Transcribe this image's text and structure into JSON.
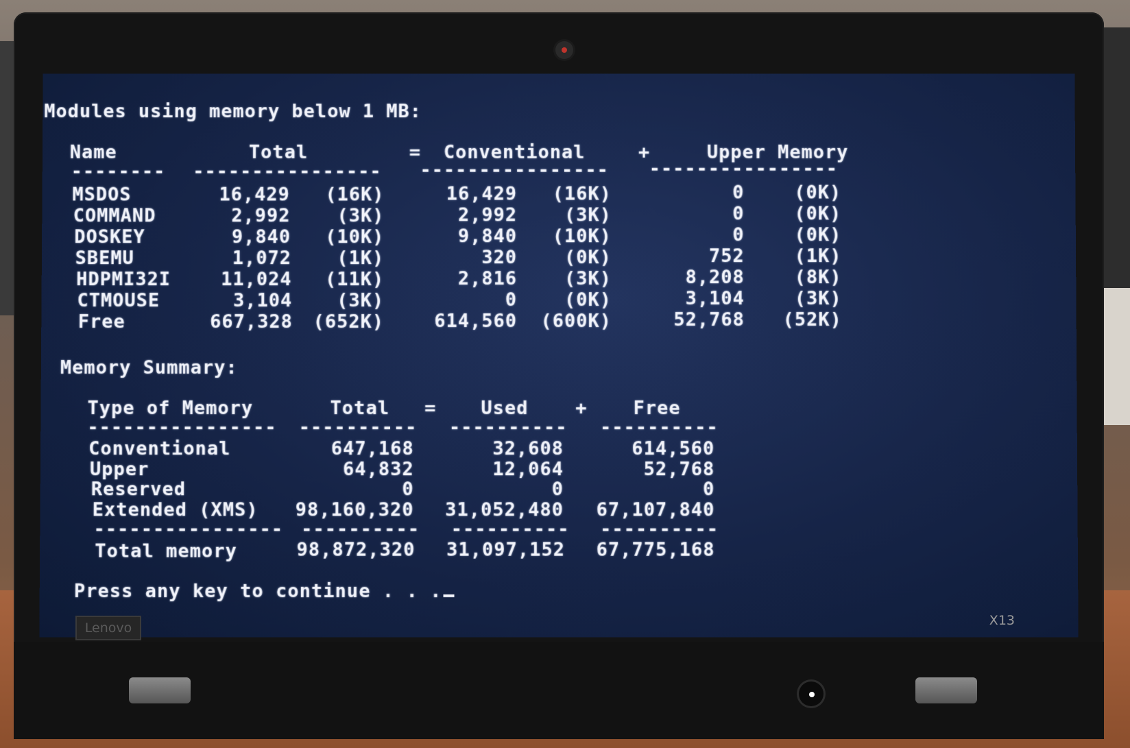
{
  "modules": {
    "heading": "Modules using memory below 1 MB:",
    "header": [
      "Name",
      "Total",
      "=",
      "Conventional",
      "+",
      "Upper Memory"
    ],
    "separator": "--------   ----------------    ----------------    ----------------",
    "rows": [
      {
        "name": "MSDOS",
        "total": "16,429",
        "total_k": "(16K)",
        "conv": "16,429",
        "conv_k": "(16K)",
        "upper": "0",
        "upper_k": "(0K)"
      },
      {
        "name": "COMMAND",
        "total": "2,992",
        "total_k": "(3K)",
        "conv": "2,992",
        "conv_k": "(3K)",
        "upper": "0",
        "upper_k": "(0K)"
      },
      {
        "name": "DOSKEY",
        "total": "9,840",
        "total_k": "(10K)",
        "conv": "9,840",
        "conv_k": "(10K)",
        "upper": "0",
        "upper_k": "(0K)"
      },
      {
        "name": "SBEMU",
        "total": "1,072",
        "total_k": "(1K)",
        "conv": "320",
        "conv_k": "(0K)",
        "upper": "752",
        "upper_k": "(1K)"
      },
      {
        "name": "HDPMI32I",
        "total": "11,024",
        "total_k": "(11K)",
        "conv": "2,816",
        "conv_k": "(3K)",
        "upper": "8,208",
        "upper_k": "(8K)"
      },
      {
        "name": "CTMOUSE",
        "total": "3,104",
        "total_k": "(3K)",
        "conv": "0",
        "conv_k": "(0K)",
        "upper": "3,104",
        "upper_k": "(3K)"
      },
      {
        "name": "Free",
        "total": "667,328",
        "total_k": "(652K)",
        "conv": "614,560",
        "conv_k": "(600K)",
        "upper": "52,768",
        "upper_k": "(52K)"
      }
    ]
  },
  "summary": {
    "heading": "Memory Summary:",
    "header": [
      "Type of Memory",
      "Total",
      "=",
      "Used",
      "+",
      "Free"
    ],
    "separator": "----------------  ----------  ----------  ----------",
    "rows": [
      {
        "type": "Conventional",
        "total": "647,168",
        "used": "32,608",
        "free": "614,560"
      },
      {
        "type": "Upper",
        "total": "64,832",
        "used": "12,064",
        "free": "52,768"
      },
      {
        "type": "Reserved",
        "total": "0",
        "used": "0",
        "free": "0"
      },
      {
        "type": "Extended (XMS)",
        "total": "98,160,320",
        "used": "31,052,480",
        "free": "67,107,840"
      }
    ],
    "total_row": {
      "type": "Total memory",
      "total": "98,872,320",
      "used": "31,097,152",
      "free": "67,775,168"
    }
  },
  "prompt": "Press any key to continue . . .",
  "laptop": {
    "logo": "Lenovo",
    "model": "X13"
  }
}
